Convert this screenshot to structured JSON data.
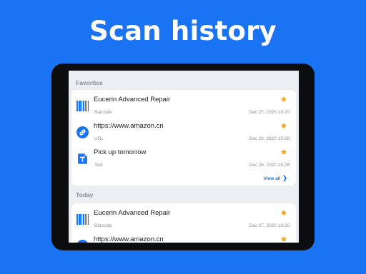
{
  "headline": "Scan history",
  "colors": {
    "background": "#1a73f2",
    "accent": "#1a73f2",
    "star": "#f5a623"
  },
  "favorites": {
    "label": "Favorites",
    "items": [
      {
        "title": "Eucerin Advanced Repair",
        "type": "Barcode",
        "date": "Dec 27, 2020  13:20",
        "icon": "barcode-icon",
        "starred": true
      },
      {
        "title": "https://www.amazon.cn",
        "type": "URL",
        "date": "Dec 26, 2020  15:28",
        "icon": "link-icon",
        "starred": true
      },
      {
        "title": "Pick up tomorrow",
        "type": "Text",
        "date": "Dec 26, 2020  15:28",
        "icon": "text-icon",
        "starred": true
      }
    ],
    "view_all": "View all"
  },
  "today": {
    "label": "Today",
    "items": [
      {
        "title": "Eucerin Advanced Repair",
        "type": "Barcode",
        "date": "Dec 27, 2020  13:20",
        "icon": "barcode-icon",
        "starred": true
      },
      {
        "title": "https://www.amazon.cn",
        "type": "",
        "date": "",
        "icon": "link-icon",
        "starred": true
      }
    ]
  }
}
